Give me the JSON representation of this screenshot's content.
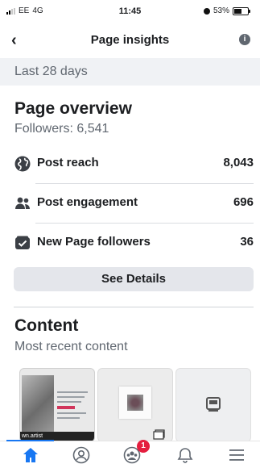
{
  "status_bar": {
    "carrier": "EE",
    "network": "4G",
    "time": "11:45",
    "battery_percent": "53%",
    "battery_level": 0.53
  },
  "nav": {
    "title": "Page insights",
    "back_icon": "chevron-left-icon",
    "info_icon": "info-icon"
  },
  "date_range": "Last 28 days",
  "overview": {
    "title": "Page overview",
    "followers": "Followers: 6,541",
    "metrics": [
      {
        "label": "Post reach",
        "value": "8,043",
        "icon": "globe-icon"
      },
      {
        "label": "Post engagement",
        "value": "696",
        "icon": "people-icon"
      },
      {
        "label": "New Page followers",
        "value": "36",
        "icon": "inbox-check-icon"
      }
    ],
    "see_details_label": "See Details"
  },
  "content": {
    "title": "Content",
    "subtitle": "Most recent content",
    "thumbnail_1_caption": "wn.artist"
  },
  "tab_bar": {
    "tabs": [
      "home-icon",
      "profile-icon",
      "groups-icon",
      "notifications-icon",
      "menu-icon"
    ],
    "groups_badge": "1",
    "active_tab": "home",
    "accent_color": "#1877f2",
    "badge_color": "#e41e3f"
  }
}
